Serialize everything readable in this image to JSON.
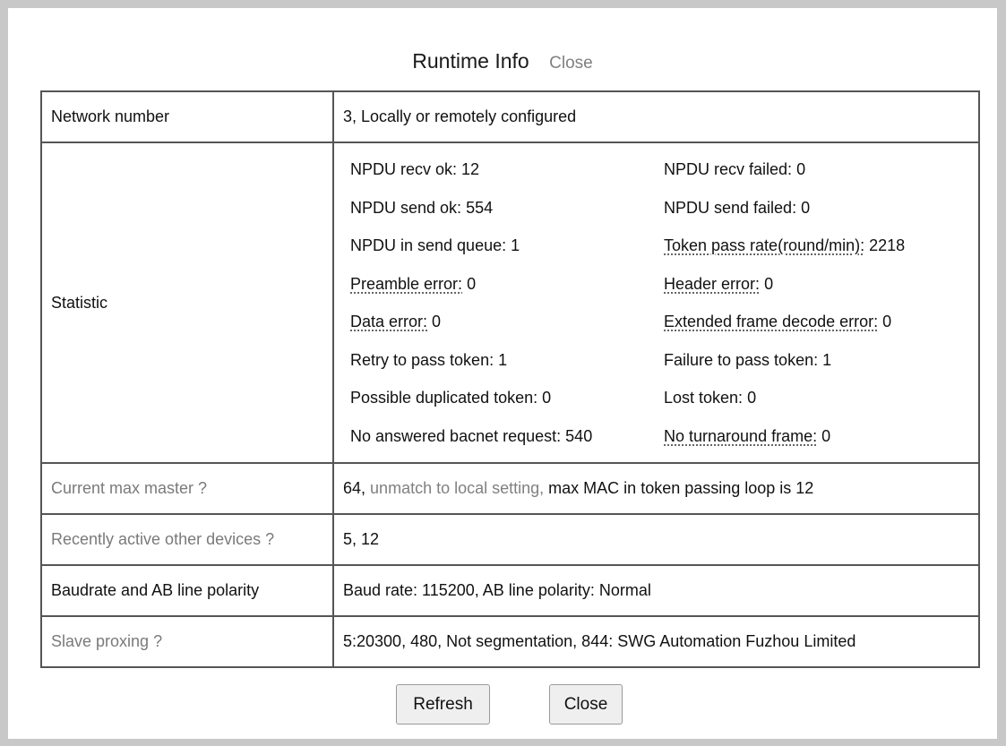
{
  "dialog": {
    "title": "Runtime Info",
    "close_link": "Close"
  },
  "rows": {
    "network": {
      "label": "Network number",
      "value": "3, Locally or remotely configured"
    },
    "statistic": {
      "label": "Statistic",
      "items": [
        {
          "label": "NPDU recv ok:",
          "value": "12",
          "hint": false
        },
        {
          "label": "NPDU recv failed:",
          "value": "0",
          "hint": false
        },
        {
          "label": "NPDU send ok:",
          "value": "554",
          "hint": false
        },
        {
          "label": "NPDU send failed:",
          "value": "0",
          "hint": false
        },
        {
          "label": "NPDU in send queue:",
          "value": "1",
          "hint": false
        },
        {
          "label": "Token pass rate(round/min):",
          "value": "2218",
          "hint": true
        },
        {
          "label": "Preamble error:",
          "value": "0",
          "hint": true
        },
        {
          "label": "Header error:",
          "value": "0",
          "hint": true
        },
        {
          "label": "Data error:",
          "value": "0",
          "hint": true
        },
        {
          "label": "Extended frame decode error:",
          "value": "0",
          "hint": true
        },
        {
          "label": "Retry to pass token:",
          "value": "1",
          "hint": false
        },
        {
          "label": "Failure to pass token:",
          "value": "1",
          "hint": false
        },
        {
          "label": "Possible duplicated token:",
          "value": "0",
          "hint": false
        },
        {
          "label": "Lost token:",
          "value": "0",
          "hint": false
        },
        {
          "label": "No answered bacnet request:",
          "value": "540",
          "hint": false
        },
        {
          "label": "No turnaround frame:",
          "value": "0",
          "hint": true
        }
      ]
    },
    "max_master": {
      "label": "Current max master ?",
      "value_prefix": "64,",
      "value_warning": "unmatch to local setting,",
      "value_suffix": "max MAC in token passing loop is 12"
    },
    "active_devices": {
      "label": "Recently active other devices ?",
      "value": "5, 12"
    },
    "baudrate": {
      "label": "Baudrate and AB line polarity",
      "value": "Baud rate: 115200, AB line polarity: Normal"
    },
    "slave_proxing": {
      "label": "Slave proxing ?",
      "value": "5:20300, 480, Not segmentation, 844: SWG Automation Fuzhou Limited"
    }
  },
  "buttons": {
    "refresh": "Refresh",
    "close": "Close"
  }
}
